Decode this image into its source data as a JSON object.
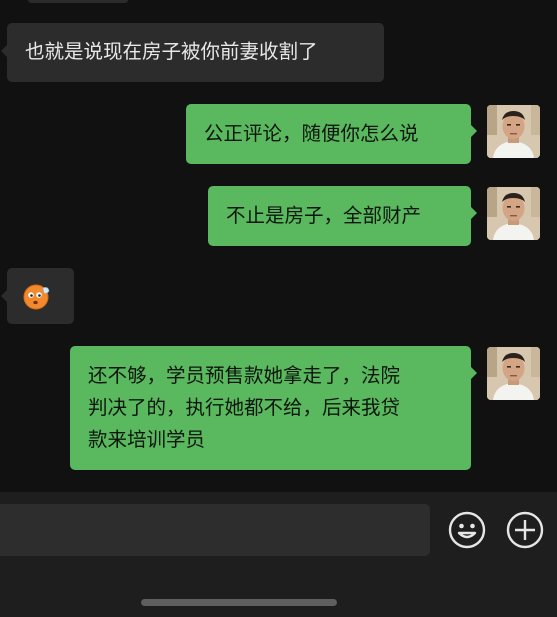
{
  "chat": {
    "messages": [
      {
        "side": "in",
        "type": "text",
        "text": "也就是说现在房子被你前妻收割了"
      },
      {
        "side": "out",
        "type": "text",
        "text": "公正评论，随便你怎么说"
      },
      {
        "side": "out",
        "type": "text",
        "text": "不止是房子，全部财产"
      },
      {
        "side": "in",
        "type": "emoji",
        "emoji": "wow-emoji-icon"
      },
      {
        "side": "out",
        "type": "text",
        "lines": [
          "还不够，学员预售款她拿走了，法院",
          "判决了的，执行她都不给，后来我贷",
          "款来培训学员"
        ]
      }
    ]
  },
  "input_bar": {
    "input_value": "",
    "emoji_button_icon": "smile-icon",
    "plus_button_icon": "plus-circle-icon"
  },
  "colors": {
    "background": "#111111",
    "incoming_bubble": "#2c2c2c",
    "outgoing_bubble": "#5ab85e",
    "input_bar": "#1e1e1e"
  }
}
